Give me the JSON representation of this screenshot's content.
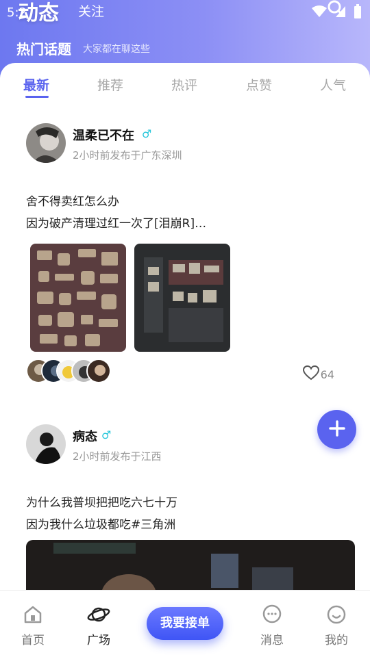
{
  "status_bar": {
    "time": "5:2"
  },
  "header": {
    "title": "动态",
    "follow_tab": "关注",
    "hot_topics_title": "热门话题",
    "hot_topics_subtitle": "大家都在聊这些"
  },
  "tabs": [
    {
      "label": "最新",
      "active": true
    },
    {
      "label": "推荐",
      "active": false
    },
    {
      "label": "热评",
      "active": false
    },
    {
      "label": "点赞",
      "active": false
    },
    {
      "label": "人气",
      "active": false
    }
  ],
  "posts": [
    {
      "username": "温柔已不在",
      "gender": "♂",
      "meta": "2小时前发布于广东深圳",
      "lines": [
        "舍不得卖红怎么办",
        "因为破产清理过红一次了[泪崩R]…"
      ],
      "like_count": "64"
    },
    {
      "username": "病态",
      "gender": "♂",
      "meta": "2小时前发布于江西",
      "lines": [
        "为什么我普坝把把吃六七十万",
        "因为我什么垃圾都吃#三角洲"
      ]
    }
  ],
  "bottom_nav": {
    "home": "首页",
    "square": "广场",
    "center": "我要接单",
    "messages": "消息",
    "mine": "我的"
  },
  "colors": {
    "accent": "#5a63ef",
    "gender_male": "#26c6da"
  }
}
